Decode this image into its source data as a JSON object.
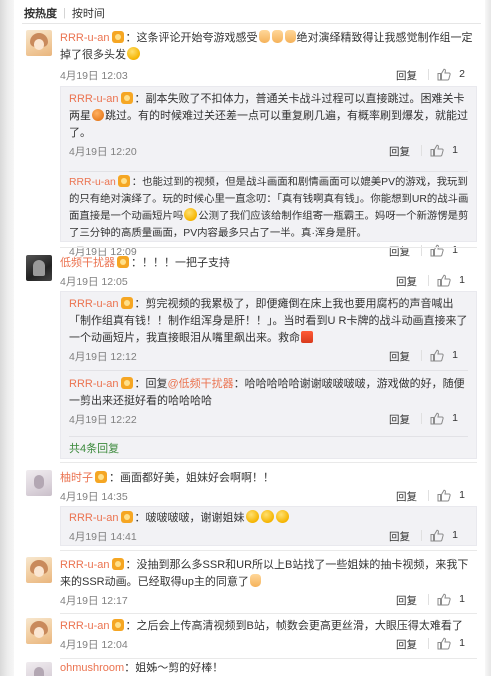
{
  "sort": {
    "hot": "按热度",
    "time": "按时间",
    "separator": "|"
  },
  "ui": {
    "reply_label": "回复"
  },
  "comments": [
    {
      "user": "RRR-u-an",
      "text_a": "：这条评论开始夸游戏感受",
      "text_b": "绝对演绎精致得让我感觉制作组一定掉了很多头发",
      "time": "4月19日 12:03",
      "likes": "2",
      "replies": [
        {
          "user": "RRR-u-an",
          "text_a": "：副本失败了不扣体力，普通关卡战斗过程可以直接跳过。困难关卡两星",
          "text_b": "跳过。有的时候难过关还差一点可以重复刷几遍，有概率刷到爆发，就能过了。",
          "time": "4月19日 12:20",
          "likes": "1"
        },
        {
          "user": "RRR-u-an",
          "text_a": "：也能过到的视频，但是战斗画面和剧情画面可以媲美PV的游戏，我玩到的只有绝对演绎了。玩的时候心里一直念叨：「真有钱啊真有钱」。你能想到UR的战斗画面直接是一个动画短片吗",
          "text_b": "公测了我们应该给制作组寄一瓶霸王。妈呀一个新游愣是剪了三分钟的高质量画面，PV内容最多只占了一半。真·浑身是肝。",
          "time": "4月19日 12:09",
          "likes": "1"
        }
      ]
    },
    {
      "user": "低频干扰器",
      "text": "：！！！一把子支持",
      "time": "4月19日 12:05",
      "likes": "1",
      "replies": [
        {
          "user": "RRR-u-an",
          "text_a": "：剪完视频的我累极了，即便瘫倒在床上我也要用腐朽的声音喊出「制作组真有钱！！制作组浑身是肝！！」。当时看到U R卡牌的战斗动画直接来了一个动画短片，我直接眼泪从嘴里飙出来。救命",
          "time": "4月19日 12:12",
          "likes": "1"
        },
        {
          "user": "RRR-u-an",
          "text_a": "：回复",
          "mention": "@低频干扰器",
          "text_b": "：哈哈哈哈哈谢谢啵啵啵啵，游戏做的好，随便一剪出来还挺好看的哈哈哈哈",
          "time": "4月19日 12:22",
          "likes": "1"
        }
      ],
      "more_replies": "共4条回复"
    },
    {
      "user": "柚时子",
      "text": "：画面都好美，姐妹好会啊啊！！",
      "time": "4月19日 14:35",
      "likes": "1",
      "replies": [
        {
          "user": "RRR-u-an",
          "text_a": "：啵啵啵啵，谢谢姐妹",
          "time": "4月19日 14:41",
          "likes": "1"
        }
      ]
    },
    {
      "user": "RRR-u-an",
      "text": "：没抽到那么多SSR和UR所以上B站找了一些姐妹的抽卡视频，来我下来的SSR动画。已经取得up主的同意了",
      "time": "4月19日 12:17",
      "likes": "1"
    },
    {
      "user": "RRR-u-an",
      "text": "：之后会上传高清视频到B站，帧数会更高更丝滑，大眼压得太难看了",
      "time": "4月19日 12:04",
      "likes": "1"
    },
    {
      "user": "ohmushroom",
      "text": "：姐姊～剪的好棒！"
    }
  ]
}
